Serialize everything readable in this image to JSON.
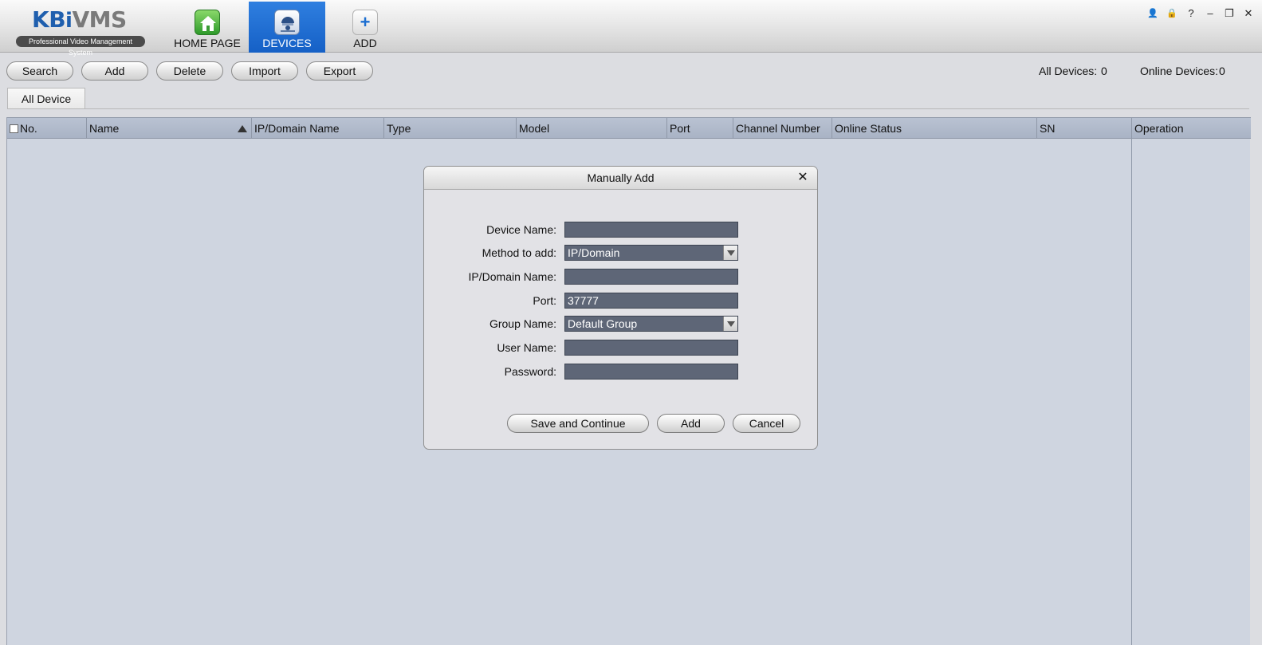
{
  "app": {
    "logo_main_kb": "KB",
    "logo_main_i": "i",
    "logo_main_vms": "VMS",
    "logo_sub": "Professional Video Management System"
  },
  "nav": {
    "home": "HOME PAGE",
    "devices": "DEVICES",
    "add": "ADD",
    "add_icon": "+"
  },
  "window_controls": {
    "user": "👤",
    "lock": "🔒",
    "help": "?",
    "minimize": "–",
    "restore": "❐",
    "close": "✕"
  },
  "toolbar": {
    "search": "Search",
    "add": "Add",
    "delete": "Delete",
    "import": "Import",
    "export": "Export"
  },
  "counts": {
    "all_label": "All Devices:",
    "all_value": "0",
    "online_label": "Online Devices:",
    "online_value": "0"
  },
  "tabs": {
    "all_device": "All Device"
  },
  "table": {
    "columns": [
      "No.",
      "Name",
      "IP/Domain Name",
      "Type",
      "Model",
      "Port",
      "Channel Number",
      "Online Status",
      "SN",
      "Operation"
    ]
  },
  "dialog": {
    "title": "Manually Add",
    "close": "✕",
    "fields": {
      "device_name": {
        "label": "Device Name:",
        "value": ""
      },
      "method": {
        "label": "Method to add:",
        "value": "IP/Domain"
      },
      "ip_domain": {
        "label": "IP/Domain Name:",
        "value": ""
      },
      "port": {
        "label": "Port:",
        "value": "37777"
      },
      "group": {
        "label": "Group Name:",
        "value": "Default Group"
      },
      "user": {
        "label": "User Name:",
        "value": ""
      },
      "password": {
        "label": "Password:",
        "value": ""
      }
    },
    "buttons": {
      "save_continue": "Save and Continue",
      "add": "Add",
      "cancel": "Cancel"
    }
  },
  "colors": {
    "accent": "#1f5fae",
    "active_nav": "#1f6fd6",
    "input_bg": "#5e6677",
    "table_bg": "#cfd5e0"
  }
}
